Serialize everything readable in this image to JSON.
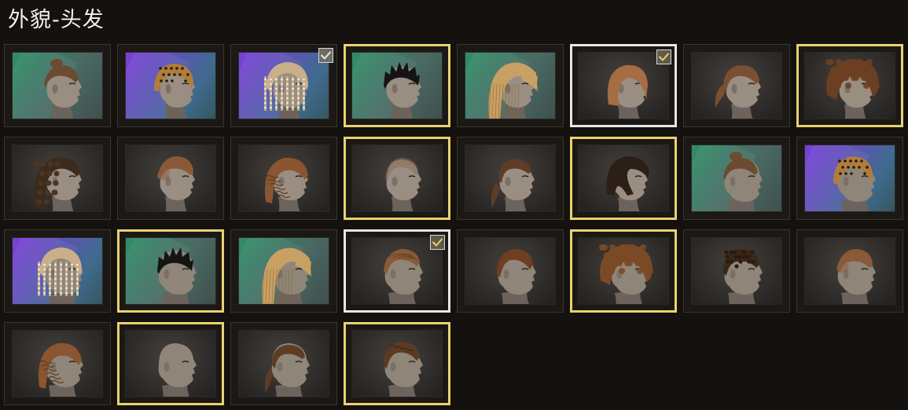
{
  "title": "外貌-头发",
  "colors": {
    "equipped_border": "#e8d272",
    "selected_border": "#e6e6e6",
    "checkmark_gold": "#f0d060",
    "checkmark_white": "#e8e8e8"
  },
  "hairstyles": [
    {
      "name": "hairstyle-01",
      "bg": "green",
      "gender": "female",
      "style": "topknot",
      "color": "#6b4b32",
      "border": "none",
      "check": "none"
    },
    {
      "name": "hairstyle-02",
      "bg": "purple",
      "gender": "female",
      "style": "leopard",
      "color": "#b07d3c",
      "border": "none",
      "check": "none"
    },
    {
      "name": "hairstyle-03",
      "bg": "purple",
      "gender": "female",
      "style": "braids",
      "color": "#c9b08a",
      "border": "none",
      "check": "white"
    },
    {
      "name": "hairstyle-04",
      "bg": "green",
      "gender": "female",
      "style": "spiky",
      "color": "#141414",
      "border": "equipped",
      "check": "none"
    },
    {
      "name": "hairstyle-05",
      "bg": "green",
      "gender": "female",
      "style": "long-crimped",
      "color": "#c9a063",
      "border": "none",
      "check": "none"
    },
    {
      "name": "hairstyle-06",
      "bg": "dark",
      "gender": "female",
      "style": "bob",
      "color": "#a66d45",
      "border": "selected",
      "check": "gold"
    },
    {
      "name": "hairstyle-07",
      "bg": "dark",
      "gender": "female",
      "style": "ponytail",
      "color": "#7a4f32",
      "border": "none",
      "check": "none"
    },
    {
      "name": "hairstyle-08",
      "bg": "dark",
      "gender": "female",
      "style": "afro",
      "color": "#6b3f22",
      "border": "equipped",
      "check": "none"
    },
    {
      "name": "hairstyle-09",
      "bg": "dark",
      "gender": "female",
      "style": "curly-dark",
      "color": "#3c2a1c",
      "border": "none",
      "check": "none"
    },
    {
      "name": "hairstyle-10",
      "bg": "dark",
      "gender": "female",
      "style": "undercut",
      "color": "#8a5a38",
      "border": "none",
      "check": "none"
    },
    {
      "name": "hairstyle-11",
      "bg": "dark",
      "gender": "female",
      "style": "wavy",
      "color": "#8a5530",
      "border": "none",
      "check": "none"
    },
    {
      "name": "hairstyle-12",
      "bg": "dark",
      "gender": "female",
      "style": "buzz",
      "color": "#8a6b55",
      "border": "equipped",
      "check": "none"
    },
    {
      "name": "hairstyle-13",
      "bg": "dark",
      "gender": "female",
      "style": "ponytail-low",
      "color": "#5e3d26",
      "border": "none",
      "check": "none"
    },
    {
      "name": "hairstyle-14",
      "bg": "dark",
      "gender": "female",
      "style": "side-swept",
      "color": "#2b1f17",
      "border": "equipped",
      "check": "none"
    },
    {
      "name": "hairstyle-15",
      "bg": "green",
      "gender": "male",
      "style": "topknot",
      "color": "#6b4b32",
      "border": "none",
      "check": "none"
    },
    {
      "name": "hairstyle-16",
      "bg": "purple",
      "gender": "male",
      "style": "leopard",
      "color": "#b07d3c",
      "border": "none",
      "check": "none"
    },
    {
      "name": "hairstyle-17",
      "bg": "purple",
      "gender": "male",
      "style": "braids",
      "color": "#c9b08a",
      "border": "none",
      "check": "none"
    },
    {
      "name": "hairstyle-18",
      "bg": "green",
      "gender": "male",
      "style": "spiky",
      "color": "#141414",
      "border": "equipped",
      "check": "none"
    },
    {
      "name": "hairstyle-19",
      "bg": "green",
      "gender": "male",
      "style": "long-crimped",
      "color": "#c9a063",
      "border": "none",
      "check": "none"
    },
    {
      "name": "hairstyle-20",
      "bg": "dark",
      "gender": "male",
      "style": "slick",
      "color": "#8a5a38",
      "border": "selected",
      "check": "gold"
    },
    {
      "name": "hairstyle-21",
      "bg": "dark",
      "gender": "male",
      "style": "short-side",
      "color": "#6e3f22",
      "border": "none",
      "check": "none"
    },
    {
      "name": "hairstyle-22",
      "bg": "dark",
      "gender": "male",
      "style": "afro",
      "color": "#7a4a26",
      "border": "equipped",
      "check": "none"
    },
    {
      "name": "hairstyle-23",
      "bg": "dark",
      "gender": "male",
      "style": "short-curly",
      "color": "#3a2718",
      "border": "none",
      "check": "none"
    },
    {
      "name": "hairstyle-24",
      "bg": "dark",
      "gender": "male",
      "style": "undercut",
      "color": "#8a5a38",
      "border": "none",
      "check": "none"
    },
    {
      "name": "hairstyle-25",
      "bg": "dark",
      "gender": "male",
      "style": "wavy",
      "color": "#8a5530",
      "border": "none",
      "check": "none"
    },
    {
      "name": "hairstyle-26",
      "bg": "dark",
      "gender": "male",
      "style": "bald",
      "color": "#8a6b55",
      "border": "equipped",
      "check": "none"
    },
    {
      "name": "hairstyle-27",
      "bg": "dark",
      "gender": "male",
      "style": "ponytail-low",
      "color": "#5e3d26",
      "border": "none",
      "check": "none"
    },
    {
      "name": "hairstyle-28",
      "bg": "dark",
      "gender": "male",
      "style": "short-wavy",
      "color": "#5a3a22",
      "border": "equipped",
      "check": "none"
    }
  ]
}
